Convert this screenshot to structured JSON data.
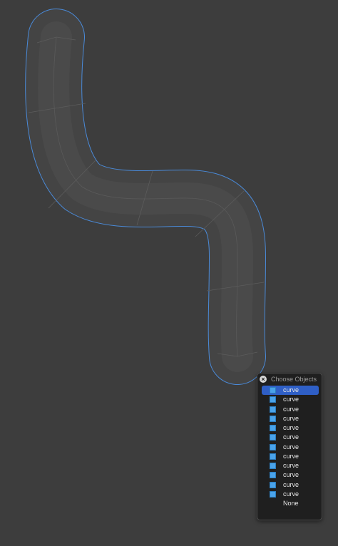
{
  "popup": {
    "title": "Choose Objects",
    "close_icon": "close-icon",
    "items": [
      {
        "label": "curve",
        "icon": "object-square-icon",
        "active": true
      },
      {
        "label": "curve",
        "icon": "object-square-icon",
        "active": false
      },
      {
        "label": "curve",
        "icon": "object-square-icon",
        "active": false
      },
      {
        "label": "curve",
        "icon": "object-square-icon",
        "active": false
      },
      {
        "label": "curve",
        "icon": "object-square-icon",
        "active": false
      },
      {
        "label": "curve",
        "icon": "object-square-icon",
        "active": false
      },
      {
        "label": "curve",
        "icon": "object-square-icon",
        "active": false
      },
      {
        "label": "curve",
        "icon": "object-square-icon",
        "active": false
      },
      {
        "label": "curve",
        "icon": "object-square-icon",
        "active": false
      },
      {
        "label": "curve",
        "icon": "object-square-icon",
        "active": false
      },
      {
        "label": "curve",
        "icon": "object-square-icon",
        "active": false
      },
      {
        "label": "curve",
        "icon": "object-square-icon",
        "active": false
      },
      {
        "label": "None",
        "icon": "",
        "active": false
      }
    ]
  },
  "colors": {
    "background": "#3d3d3d",
    "selection_outline": "#4a8ad8",
    "item_highlight": "#2f5fc6",
    "object_square": "#4aa3ea"
  }
}
